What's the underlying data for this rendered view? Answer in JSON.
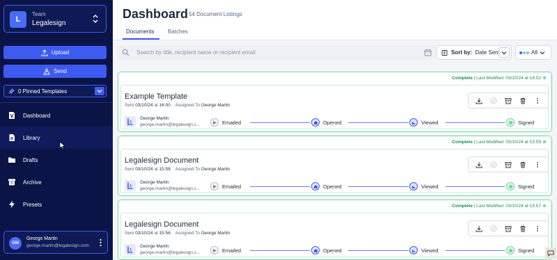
{
  "sidebar": {
    "team_label": "Team",
    "team_name": "Legalesign",
    "team_badge": "L",
    "upload_label": "Upload",
    "send_label": "Send",
    "pinned_label": "0 Pinned Templates",
    "nav": [
      {
        "label": "Dashboard",
        "icon": "dashboard-icon"
      },
      {
        "label": "Library",
        "icon": "document-icon"
      },
      {
        "label": "Drafts",
        "icon": "folder-icon"
      },
      {
        "label": "Archive",
        "icon": "archive-icon"
      },
      {
        "label": "Presets",
        "icon": "lightning-icon"
      }
    ],
    "user": {
      "initials": "GM",
      "name": "George Martin",
      "email": "george.martin@legalesign.com"
    }
  },
  "header": {
    "title": "Dashboard",
    "subtitle": "54 Document Listings",
    "tabs": [
      "Documents",
      "Batches"
    ]
  },
  "toolbar": {
    "search_placeholder": "Search by title, recipient name or recipient email",
    "sort_prefix": "Sort by:",
    "sort_value": "Date Sent",
    "filter_value": "All"
  },
  "documents": [
    {
      "status": "Complete",
      "modified": "Last Modified: 03/10/24 at 16:02",
      "title": "Example Template",
      "sent_prefix": "Sent",
      "sent_date": "03/10/24",
      "sent_at": "at",
      "sent_time": "16:00",
      "assigned_prefix": "Assigned To",
      "assigned_to": "George Martin",
      "signer_name": "George Martin",
      "signer_email": "george.martin@legalesign.c...",
      "steps": [
        "Emailed",
        "Opened",
        "Viewed",
        "Signed"
      ]
    },
    {
      "status": "Complete",
      "modified": "Last Modified: 03/10/24 at 15:59",
      "title": "Legalesign Document",
      "sent_prefix": "Sent",
      "sent_date": "03/10/24",
      "sent_at": "at",
      "sent_time": "15:58",
      "assigned_prefix": "Assigned To",
      "assigned_to": "George Martin",
      "signer_name": "George Martin",
      "signer_email": "george.martin@legalesign.c...",
      "steps": [
        "Emailed",
        "Opened",
        "Viewed",
        "Signed"
      ]
    },
    {
      "status": "Complete",
      "modified": "Last Modified: 03/10/24 at 15:57",
      "title": "Legalesign Document",
      "sent_prefix": "Sent",
      "sent_date": "03/10/24",
      "sent_at": "at",
      "sent_time": "15:56",
      "assigned_prefix": "Assigned To",
      "assigned_to": "George Martin",
      "signer_name": "George Martin",
      "signer_email": "george.martin@legalesign.c...",
      "steps": [
        "Emailed",
        "Opened",
        "Viewed",
        "Signed"
      ]
    }
  ],
  "colors": {
    "sidebar_bg": "#0b1447",
    "accent": "#3d5af1",
    "complete_green": "#1d8a53"
  }
}
